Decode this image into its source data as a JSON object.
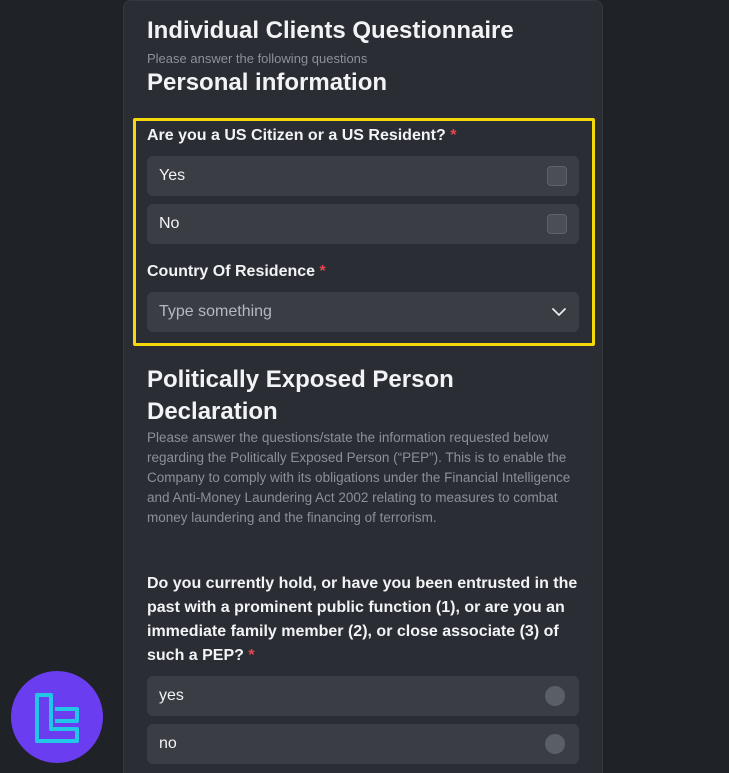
{
  "form": {
    "title": "Individual Clients Questionnaire",
    "subtitle": "Please answer the following questions",
    "section1_title": "Personal information",
    "us_question": "Are you a US Citizen or a US Resident?",
    "required_mark": "*",
    "us_options": [
      "Yes",
      "No"
    ],
    "country_label": "Country Of Residence",
    "country_placeholder": "Type something",
    "section2_title": "Politically Exposed Person Declaration",
    "section2_desc": "Please answer the questions/state the information requested below regarding the Politically Exposed Person (“PEP”). This is to enable the Company to comply with its obligations under the Financial Intelligence and Anti-Money Laundering Act 2002 relating to measures to combat money laundering and the financing of terrorism.",
    "pep_question": "Do you currently hold, or have you been entrusted in the past with a prominent public function (1), or are you an immediate family member (2), or close associate (3) of such a PEP?",
    "pep_options": [
      "yes",
      "no"
    ]
  },
  "colors": {
    "highlight": "#f5d90a",
    "logo_bg": "#6b3df0",
    "logo_fg": "#22c7e8"
  },
  "icons": {
    "dropdown": "chevron-down-icon",
    "logo": "brand-logo-icon"
  }
}
